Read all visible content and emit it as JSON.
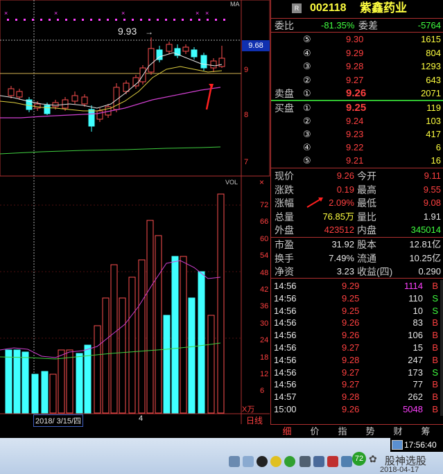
{
  "chart": {
    "ma_label": "MA",
    "high_annotation": "9.93",
    "current_price_tag": "9.68",
    "price_axis": [
      "9",
      "8",
      "7"
    ],
    "vol_label": "VOL",
    "vol_axis": [
      "72",
      "66",
      "60",
      "54",
      "48",
      "42",
      "36",
      "30",
      "24",
      "18",
      "12",
      "6"
    ],
    "vol_unit": "X万",
    "date_label": "2018/ 3/15/四",
    "month_tick": "4",
    "period_label": "日线"
  },
  "quote": {
    "badge": "R",
    "code": "002118",
    "name": "紫鑫药业",
    "weibi_label": "委比",
    "weibi_value": "-81.35%",
    "weicha_label": "委差",
    "weicha_value": "-5764",
    "asks": [
      {
        "num": "⑤",
        "price": "9.30",
        "vol": "1615"
      },
      {
        "num": "④",
        "price": "9.29",
        "vol": "804"
      },
      {
        "num": "③",
        "price": "9.28",
        "vol": "1293"
      },
      {
        "num": "②",
        "price": "9.27",
        "vol": "643"
      }
    ],
    "ask1": {
      "label": "卖盘",
      "num": "①",
      "price": "9.26",
      "vol": "2071"
    },
    "bid1": {
      "label": "买盘",
      "num": "①",
      "price": "9.25",
      "vol": "119"
    },
    "bids": [
      {
        "num": "②",
        "price": "9.24",
        "vol": "103"
      },
      {
        "num": "③",
        "price": "9.23",
        "vol": "417"
      },
      {
        "num": "④",
        "price": "9.22",
        "vol": "6"
      },
      {
        "num": "⑤",
        "price": "9.21",
        "vol": "16"
      }
    ],
    "stats": [
      {
        "l1": "现价",
        "v1": "9.26",
        "c1": "red",
        "l2": "今开",
        "v2": "9.11",
        "c2": "red"
      },
      {
        "l1": "涨跌",
        "v1": "0.19",
        "c1": "red",
        "l2": "最高",
        "v2": "9.55",
        "c2": "red"
      },
      {
        "l1": "涨幅",
        "v1": "2.09%",
        "c1": "red",
        "l2": "最低",
        "v2": "9.08",
        "c2": "red"
      },
      {
        "l1": "总量",
        "v1": "76.85万",
        "c1": "yellow",
        "l2": "量比",
        "v2": "1.91",
        "c2": "white"
      },
      {
        "l1": "外盘",
        "v1": "423512",
        "c1": "red",
        "l2": "内盘",
        "v2": "345014",
        "c2": "green"
      }
    ],
    "fund": [
      {
        "l1": "市盈",
        "v1": "31.92",
        "l2": "股本",
        "v2": "12.81亿"
      },
      {
        "l1": "换手",
        "v1": "7.49%",
        "l2": "流通",
        "v2": "10.25亿"
      },
      {
        "l1": "净资",
        "v1": "3.23",
        "l2": "收益(四)",
        "v2": "0.290"
      }
    ],
    "ticks": [
      {
        "time": "14:56",
        "price": "9.29",
        "vol": "1114",
        "vc": "magenta",
        "side": "B",
        "sc": "red"
      },
      {
        "time": "14:56",
        "price": "9.25",
        "vol": "110",
        "vc": "white",
        "side": "S",
        "sc": "green"
      },
      {
        "time": "14:56",
        "price": "9.25",
        "vol": "10",
        "vc": "white",
        "side": "S",
        "sc": "green"
      },
      {
        "time": "14:56",
        "price": "9.26",
        "vol": "83",
        "vc": "white",
        "side": "B",
        "sc": "red"
      },
      {
        "time": "14:56",
        "price": "9.26",
        "vol": "106",
        "vc": "white",
        "side": "B",
        "sc": "red"
      },
      {
        "time": "14:56",
        "price": "9.27",
        "vol": "15",
        "vc": "white",
        "side": "B",
        "sc": "red"
      },
      {
        "time": "14:56",
        "price": "9.28",
        "vol": "247",
        "vc": "white",
        "side": "B",
        "sc": "red"
      },
      {
        "time": "14:56",
        "price": "9.27",
        "vol": "173",
        "vc": "white",
        "side": "S",
        "sc": "green"
      },
      {
        "time": "14:56",
        "price": "9.27",
        "vol": "77",
        "vc": "white",
        "side": "B",
        "sc": "red"
      },
      {
        "time": "14:57",
        "price": "9.28",
        "vol": "262",
        "vc": "white",
        "side": "B",
        "sc": "red"
      },
      {
        "time": "15:00",
        "price": "9.26",
        "vol": "5048",
        "vc": "magenta",
        "side": "B",
        "sc": "red"
      }
    ]
  },
  "tabs": [
    "细",
    "价",
    "指",
    "势",
    "财",
    "筹"
  ],
  "taskbar": {
    "time": "17:56:40",
    "date": "2018-04-17",
    "badge": "72",
    "watermark": "股神选股"
  }
}
